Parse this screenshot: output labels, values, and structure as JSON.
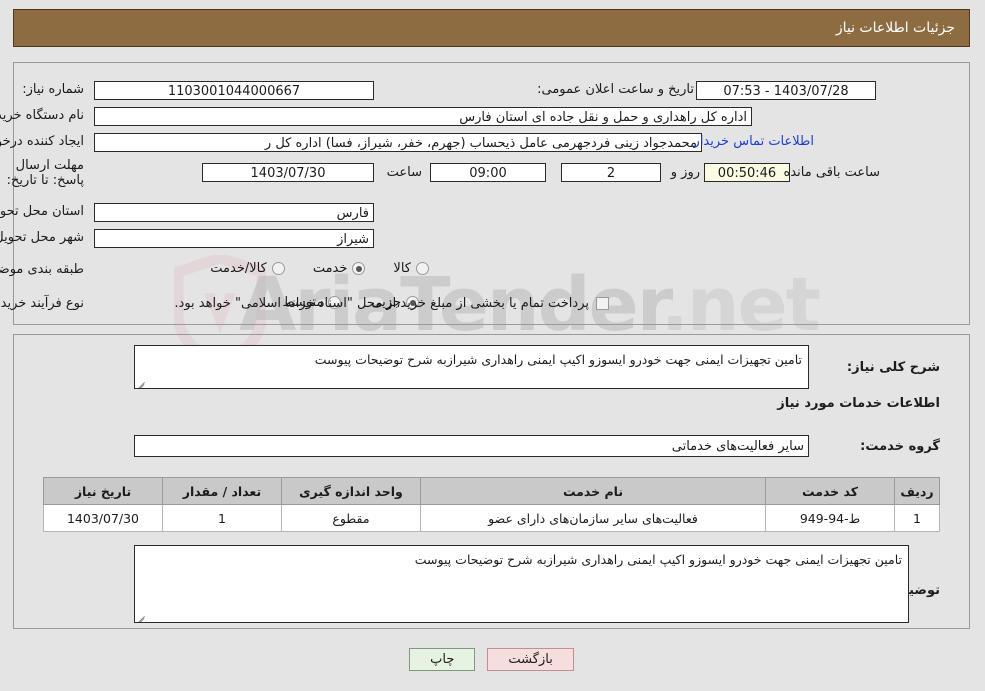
{
  "header": {
    "title": "جزئیات اطلاعات نیاز",
    "bar_color": "#8d6c42"
  },
  "watermark": {
    "text": "AriaTender",
    "suffix": ".net"
  },
  "form": {
    "need_number": {
      "label": "شماره نیاز:",
      "value": "1103001044000667"
    },
    "announce_datetime": {
      "label": "تاریخ و ساعت اعلان عمومی:",
      "value": "1403/07/28 - 07:53"
    },
    "buyer_org": {
      "label": "نام دستگاه خریدار:",
      "value": "اداره کل راهداری و حمل و نقل جاده ای استان فارس"
    },
    "request_creator": {
      "label": "ایجاد کننده درخواست:",
      "value": "محمدجواد زینی فردجهرمی عامل ذیحساب (جهرم، خفر، شیراز، فسا) اداره کل ر",
      "contact_link": "اطلاعات تماس خریدار"
    },
    "deadline": {
      "label": "مهلت ارسال پاسخ: تا تاریخ:",
      "date": "1403/07/30",
      "time_label": "ساعت",
      "time": "09:00",
      "days": "2",
      "days_label": "روز و",
      "countdown": "00:50:46",
      "countdown_label": "ساعت باقی مانده"
    },
    "delivery_province": {
      "label": "استان محل تحویل:",
      "value": "فارس"
    },
    "delivery_city": {
      "label": "شهر محل تحویل:",
      "value": "شیراز"
    },
    "category": {
      "label": "طبقه بندی موضوعی:",
      "options": [
        {
          "label": "کالا",
          "selected": false
        },
        {
          "label": "خدمت",
          "selected": true
        },
        {
          "label": "کالا/خدمت",
          "selected": false
        }
      ]
    },
    "purchase_type": {
      "label": "نوع فرآیند خرید :",
      "options": [
        {
          "label": "جزیی",
          "selected": true
        },
        {
          "label": "متوسط",
          "selected": false
        }
      ],
      "checkbox_label": "پرداخت تمام یا بخشی از مبلغ خرید،از محل \"اسناد خزانه اسلامی\" خواهد بود.",
      "checkbox_checked": false
    }
  },
  "sections": {
    "general_desc": {
      "label": "شرح کلی نیاز:",
      "value": "تامین تجهیزات ایمنی جهت خودرو ایسوزو اکیپ ایمنی راهداری شیرازبه شرح توضیحات پیوست"
    },
    "services_info_heading": "اطلاعات خدمات مورد نیاز",
    "service_group": {
      "label": "گروه خدمت:",
      "value": "سایر فعالیت‌های خدماتی"
    },
    "buyer_notes": {
      "label": "توضیحات خریدار:",
      "value": "تامین تجهیزات ایمنی جهت خودرو ایسوزو اکیپ ایمنی راهداری شیرازبه شرح توضیحات پیوست"
    }
  },
  "table": {
    "columns": [
      "ردیف",
      "کد خدمت",
      "نام خدمت",
      "واحد اندازه گیری",
      "تعداد / مقدار",
      "تاریخ نیاز"
    ],
    "rows": [
      {
        "index": "1",
        "service_code": "ط-94-949",
        "service_name": "فعالیت‌های سایر سازمان‌های دارای عضو",
        "unit": "مقطوع",
        "quantity": "1",
        "need_date": "1403/07/30"
      }
    ]
  },
  "buttons": {
    "print": "چاپ",
    "back": "بازگشت"
  }
}
